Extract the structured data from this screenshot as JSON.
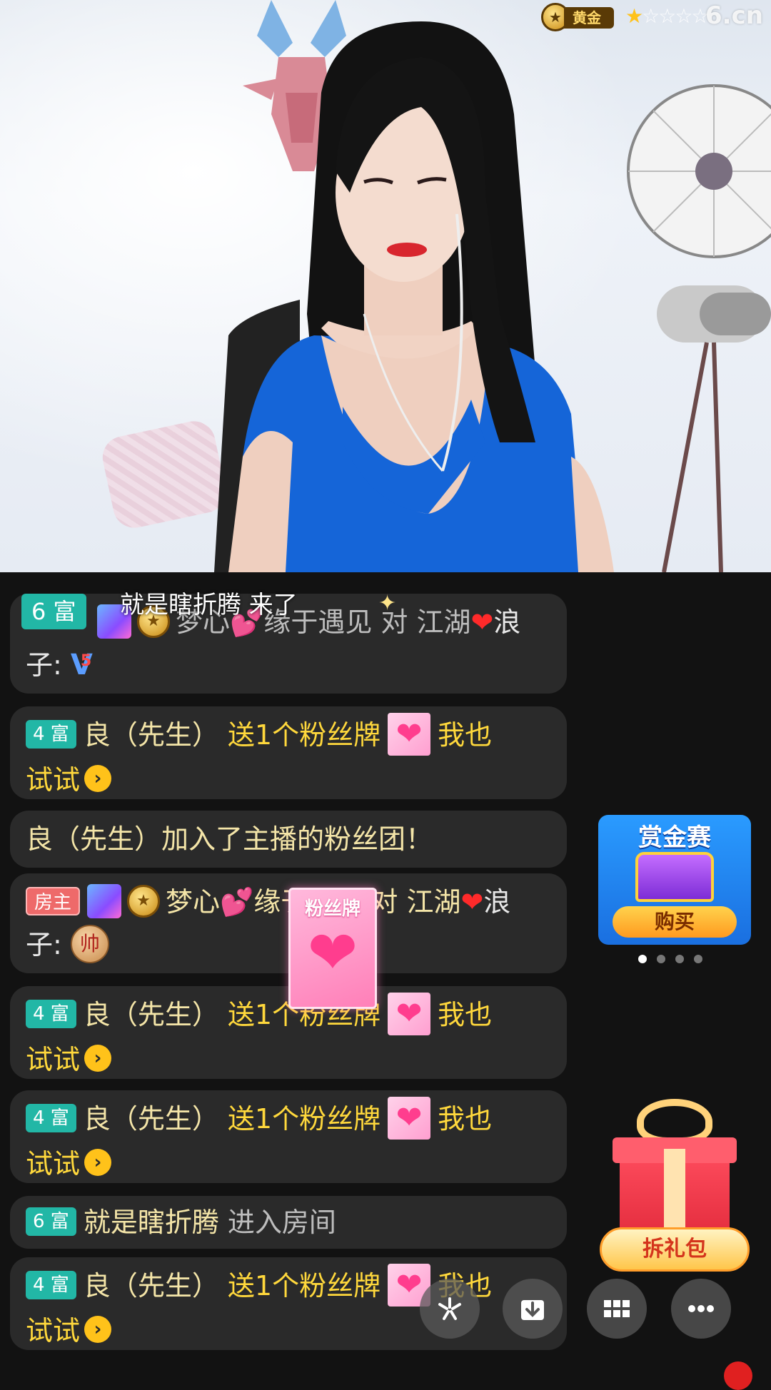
{
  "header": {
    "level_label": "黄金",
    "stars_on": 1,
    "stars_total": 5,
    "site_logo": "6.cn"
  },
  "entry_banner": {
    "badge": "6 富",
    "text": "就是瞎折腾 来了"
  },
  "chat": [
    {
      "badge": "6 富",
      "text_a": "梦心💕缘于遇见 对 江湖",
      "text_b": "浪",
      "text_c": "子:"
    },
    {
      "badge": "4 富",
      "name": "良（先生）",
      "action": "送1个粉丝牌",
      "tail": "我也",
      "tail2": "试试"
    },
    {
      "system": "良（先生）加入了主播的粉丝团！"
    },
    {
      "badge": "房主",
      "name": "梦心💕缘于遇见 对 江湖",
      "tail": "浪",
      "tail2": "子:",
      "shuai": "帅"
    },
    {
      "badge": "4 富",
      "name": "良（先生）",
      "action": "送1个粉丝牌",
      "tail": "我也",
      "tail2": "试试"
    },
    {
      "badge": "4 富",
      "name": "良（先生）",
      "action": "送1个粉丝牌",
      "tail": "我也",
      "tail2": "试试"
    },
    {
      "badge": "6 富",
      "name": "就是瞎折腾",
      "action": "进入房间"
    },
    {
      "badge": "4 富",
      "name": "良（先生）",
      "action": "送1个粉丝牌",
      "tail": "我也",
      "tail2": "试试"
    }
  ],
  "fan_card": {
    "title": "粉丝牌"
  },
  "bounty": {
    "title": "赏金赛",
    "button": "购买",
    "page_index": 0,
    "page_count": 4
  },
  "gift_pack": {
    "button": "拆礼包"
  },
  "toolbar": [
    {
      "icon": "share-icon"
    },
    {
      "icon": "download-icon"
    },
    {
      "icon": "grid-icon"
    },
    {
      "icon": "more-icon"
    }
  ],
  "colors": {
    "rich_badge": "#22b7a6",
    "host_badge": "#ee6a6a",
    "gift_text": "#ffd83c",
    "bubble": "#2a2a2a"
  }
}
